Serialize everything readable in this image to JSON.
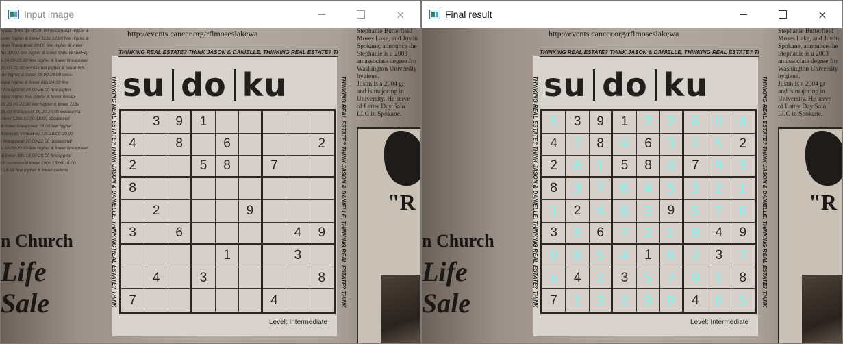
{
  "windows": [
    {
      "title": "Input image",
      "url": "http://events.cancer.org/rflmoseslakewa",
      "banner": "THINKING REAL ESTATE? THINK JASON & DANIELLE. THINKING REAL ESTATE? THINK",
      "logo": {
        "a": "su",
        "b": "do",
        "c": "ku"
      },
      "level": "Level: Intermediate",
      "church": "n Church",
      "life": "Life",
      "sale": "Sale",
      "ad_letter": "\"R",
      "left_lines": [
        "power 100s 18.00-20.00 fineappear higher &",
        "ower higher & lower 113s 18.00 few higher &",
        "ower fineappear 20.00 few higher & lower",
        "fns 18.00 few higher & lower Gale WAExFcy",
        "s 24.00-26.00 few higher & lower fineappear",
        "20.00-22.00 occasional higher & lower 80s",
        "ow higher & lower 26.00-28.00 occa-",
        "ional higher & lower 88s 24.00 few",
        "r fineappear 24.00-26.00 few higher",
        "ional higher few higher & lower fineap-",
        "00 20.00-22.00 few higher & lower 113s",
        "18.00 fineappear 18.00-20.00 occasional",
        "lower 120s 15.00-18.00 occasional",
        "& lower fineappear 18.00 few higher",
        "Braeburn WAExFcy 72s 18.00-20.00",
        "r fineappear 20.00-22.00 occasional",
        "s 18.00-20.00 few higher & lower fineappear",
        "al lower 88s 18.00-20.00 fineappear",
        "00 occasional lower 100s 15.00-16.00",
        "r 18.00 few higher & lower cartons"
      ],
      "right_lines": [
        "Stephanie Butterfield",
        "Moses Lake, and Justin",
        "Spokane, announce the",
        "Stephanie is a 2003",
        "an associate degree fro",
        "Washington University",
        "hygiene.",
        "Justin is a 2004 gr",
        "and is majoring in",
        "University. He serve",
        "of Latter Day Sain",
        "LLC in Spokane.",
        "The wedding is"
      ],
      "controls": {
        "minimize": "minimize",
        "maximize": "maximize",
        "close": "×"
      },
      "grid": [
        [
          "",
          "3",
          "9",
          "1",
          "",
          "",
          "",
          "",
          ""
        ],
        [
          "4",
          "",
          "8",
          "",
          "6",
          "",
          "",
          "",
          "2"
        ],
        [
          "2",
          "",
          "",
          "5",
          "8",
          "",
          "7",
          "",
          ""
        ],
        [
          "8",
          "",
          "",
          "",
          "",
          "",
          "",
          "",
          ""
        ],
        [
          "",
          "2",
          "",
          "",
          "",
          "9",
          "",
          "",
          ""
        ],
        [
          "3",
          "",
          "6",
          "",
          "",
          "",
          "",
          "4",
          "9"
        ],
        [
          "",
          "",
          "",
          "",
          "1",
          "",
          "",
          "3",
          ""
        ],
        [
          "",
          "4",
          "",
          "3",
          "",
          "",
          "",
          "",
          "8"
        ],
        [
          "7",
          "",
          "",
          "",
          "",
          "",
          "4",
          "",
          ""
        ]
      ],
      "solved": []
    },
    {
      "title": "Final result",
      "url": "http://events.cancer.org/rflmoseslakewa",
      "banner": "THINKING REAL ESTATE? THINK JASON & DANIELLE. THINKING REAL ESTATE? THINK",
      "logo": {
        "a": "su",
        "b": "do",
        "c": "ku"
      },
      "level": "Level: Intermediate",
      "church": "n Church",
      "life": "Life",
      "sale": "Sale",
      "ad_letter": "\"R",
      "left_lines": [],
      "right_lines": [
        "Stephanie Butterfield",
        "Moses Lake, and Justin",
        "Spokane, announce the",
        "Stephanie is a 2003",
        "an associate degree fro",
        "Washington University",
        "hygiene.",
        "Justin is a 2004 gr",
        "and is majoring in",
        "University. He serve",
        "of Latter Day Sain",
        "LLC in Spokane.",
        "The wedding is"
      ],
      "controls": {
        "minimize": "minimize",
        "maximize": "maximize",
        "close": "×"
      },
      "grid": [
        [
          "5",
          "3",
          "9",
          "1",
          "7",
          "2",
          "6",
          "8",
          "4"
        ],
        [
          "4",
          "7",
          "8",
          "9",
          "6",
          "3",
          "1",
          "5",
          "2"
        ],
        [
          "2",
          "6",
          "1",
          "5",
          "8",
          "4",
          "7",
          "9",
          "3"
        ],
        [
          "8",
          "9",
          "7",
          "6",
          "4",
          "5",
          "3",
          "2",
          "1"
        ],
        [
          "1",
          "2",
          "4",
          "8",
          "3",
          "9",
          "5",
          "7",
          "6"
        ],
        [
          "3",
          "5",
          "6",
          "7",
          "2",
          "1",
          "8",
          "4",
          "9"
        ],
        [
          "9",
          "8",
          "5",
          "4",
          "1",
          "6",
          "2",
          "3",
          "7"
        ],
        [
          "6",
          "4",
          "2",
          "3",
          "5",
          "7",
          "9",
          "1",
          "8"
        ],
        [
          "7",
          "1",
          "3",
          "2",
          "9",
          "8",
          "4",
          "6",
          "5"
        ]
      ],
      "solved": [
        [
          1,
          0,
          0,
          0,
          1,
          1,
          1,
          1,
          1
        ],
        [
          0,
          1,
          0,
          1,
          0,
          1,
          1,
          1,
          0
        ],
        [
          0,
          1,
          1,
          0,
          0,
          1,
          0,
          1,
          1
        ],
        [
          0,
          1,
          1,
          1,
          1,
          1,
          1,
          1,
          1
        ],
        [
          1,
          0,
          1,
          1,
          1,
          0,
          1,
          1,
          1
        ],
        [
          0,
          1,
          0,
          1,
          1,
          1,
          1,
          0,
          0
        ],
        [
          1,
          1,
          1,
          1,
          0,
          1,
          1,
          0,
          1
        ],
        [
          1,
          0,
          1,
          0,
          1,
          1,
          1,
          1,
          0
        ],
        [
          0,
          1,
          1,
          1,
          1,
          1,
          0,
          1,
          1
        ]
      ]
    }
  ],
  "colors": {
    "solved_digit": "#7df2f0",
    "printed_digit": "#2a2521"
  }
}
